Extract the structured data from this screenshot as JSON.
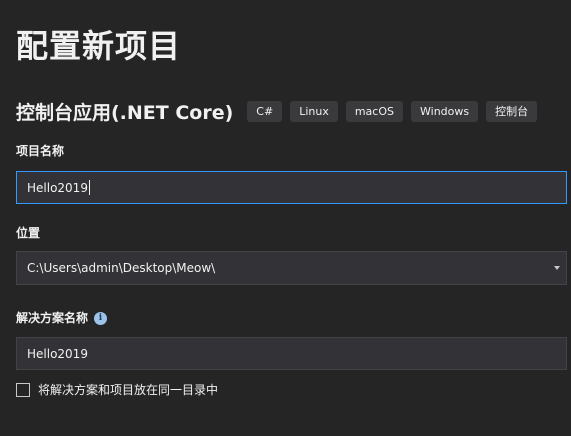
{
  "page": {
    "title": "配置新项目"
  },
  "template": {
    "name": "控制台应用(.NET Core)",
    "tags": [
      "C#",
      "Linux",
      "macOS",
      "Windows",
      "控制台"
    ]
  },
  "project_name": {
    "label": "项目名称",
    "value": "Hello2019"
  },
  "location": {
    "label": "位置",
    "value": "C:\\Users\\admin\\Desktop\\Meow\\"
  },
  "solution_name": {
    "label": "解决方案名称",
    "value": "Hello2019"
  },
  "same_directory": {
    "label": "将解决方案和项目放在同一目录中",
    "checked": false
  },
  "icons": {
    "info": "info-icon",
    "dropdown": "chevron-down-icon"
  },
  "colors": {
    "background": "#252526",
    "field": "#333337",
    "focus_border": "#3399ff",
    "tag": "#3a3a3d"
  }
}
